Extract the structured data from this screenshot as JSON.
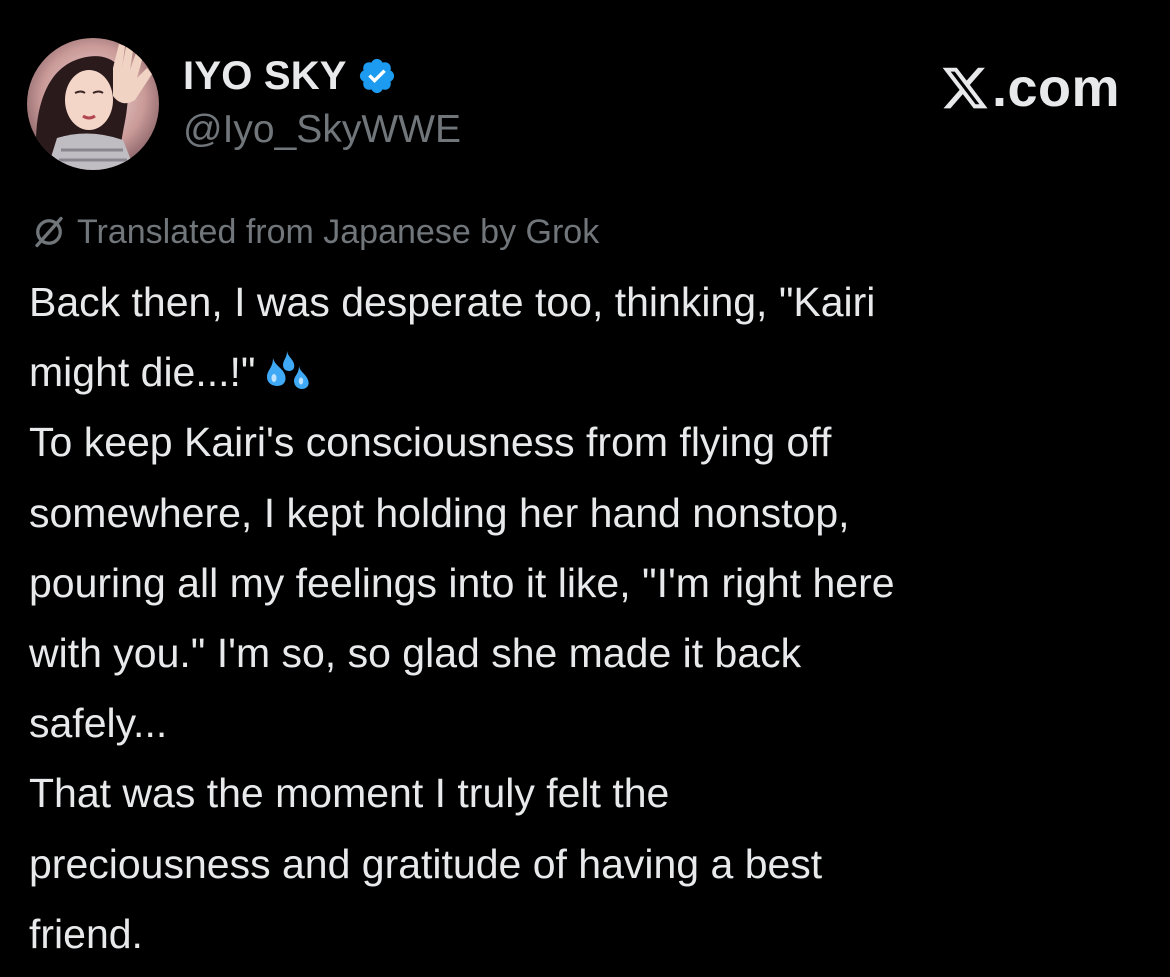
{
  "author": {
    "display_name": "IYO SKY",
    "handle": "@Iyo_SkyWWE",
    "verified": true,
    "avatar_icon": "avatar-photo"
  },
  "brand": {
    "logo_icon": "x-logo-icon",
    "suffix": ".com"
  },
  "translation_note": {
    "icon": "grok-icon",
    "text": "Translated from Japanese by Grok"
  },
  "tweet": {
    "lines": [
      "Back then, I was desperate too, thinking, \"Kairi",
      "might die...!\"",
      "To keep Kairi's consciousness from flying off",
      "somewhere, I kept holding her hand nonstop,",
      "pouring all my feelings into it like, \"I'm right here",
      "with you.\" I'm so, so glad she made it back",
      "safely...",
      "That was the moment I truly felt the",
      "preciousness and gratitude of having a best",
      "friend."
    ],
    "emoji_after_line_2": "sweat-droplets-emoji"
  },
  "colors": {
    "background": "#000000",
    "text_primary": "#e7e9ea",
    "text_secondary": "#71767b",
    "verified_blue": "#1d9bf0",
    "emoji_blue": "#3fa9f5"
  }
}
